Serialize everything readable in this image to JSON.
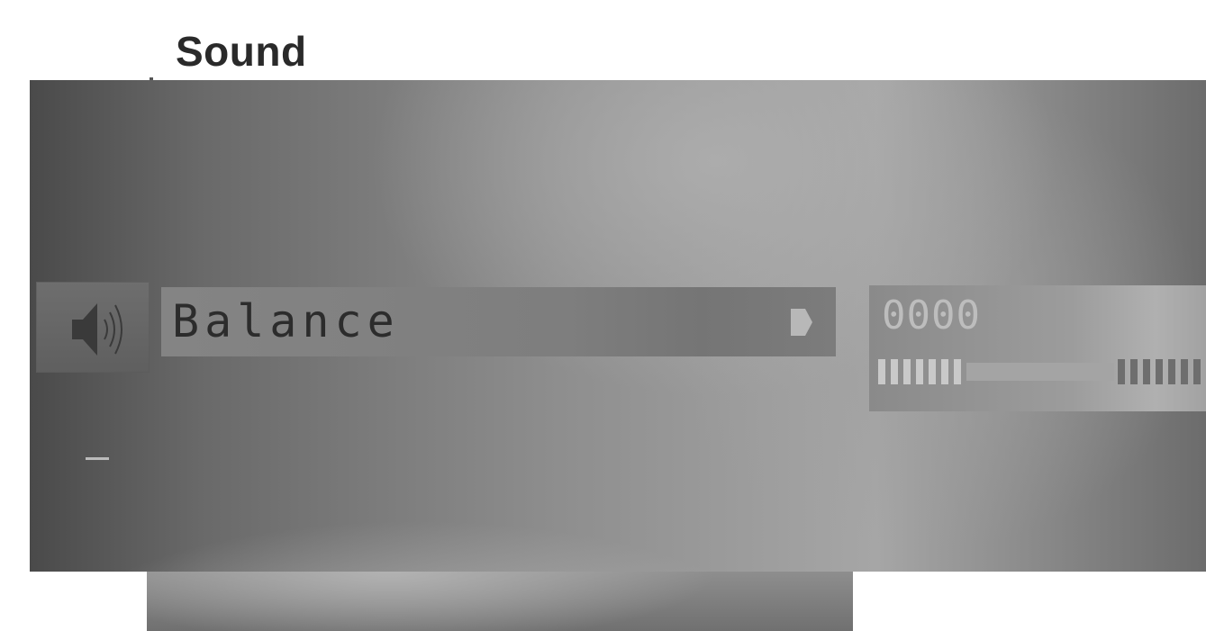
{
  "page": {
    "title": "Sound"
  },
  "menu": {
    "section_icon": "speaker-icon",
    "selected_item": {
      "label": "Balance",
      "arrow_icon": "arrow-right-icon"
    }
  },
  "balance": {
    "readout": "0000",
    "level": 0.5,
    "left_segments": 7,
    "right_segments": 7
  },
  "colors": {
    "panel_light": "#a6a6a6",
    "panel_dark": "#4a4a4a",
    "label_text": "#2c2c2c",
    "readout_text": "#bdbdbd"
  }
}
